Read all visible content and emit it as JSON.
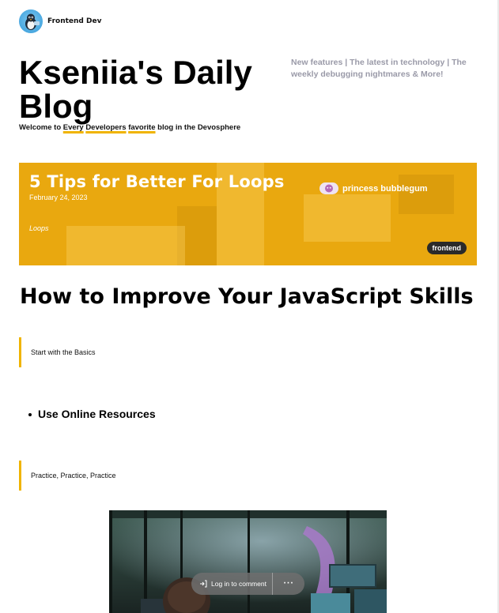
{
  "brand": {
    "name": "Frontend Dev",
    "avatar_icon": "penguin-icon"
  },
  "blog": {
    "title": "Kseniia's Daily Blog",
    "tagline": "New features | The latest in technology | The weekly debugging nightmares & More!",
    "welcome_parts": [
      "Welcome to ",
      "Every",
      " ",
      "Developers",
      " ",
      "favorite",
      " blog in the Devosphere"
    ]
  },
  "featured": {
    "title": "5 Tips for Better For Loops",
    "date": "February 24, 2023",
    "category": "Loops",
    "author": "princess bubblegum",
    "tag": "frontend",
    "card_color": "#e9a80f"
  },
  "article": {
    "title": "How to Improve Your JavaScript Skills",
    "quote_1": "Start with the Basics",
    "bullet_1": "Use Online Resources",
    "quote_2": "Practice, Practice, Practice"
  },
  "comment_bar": {
    "login_label": "Log in to comment",
    "more_label": "···",
    "login_icon": "login-icon"
  },
  "colors": {
    "accent": "#f0b400",
    "tagline_gray": "#9a9aa8"
  }
}
